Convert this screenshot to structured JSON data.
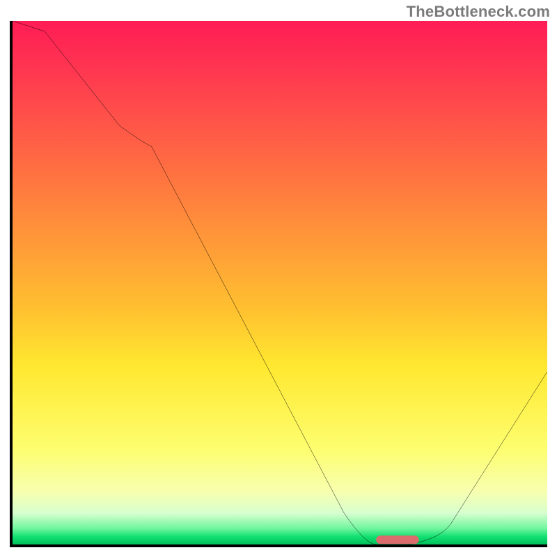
{
  "attribution": "TheBottleneck.com",
  "chart_data": {
    "type": "line",
    "title": "",
    "xlabel": "",
    "ylabel": "",
    "xlim": [
      0,
      100
    ],
    "ylim": [
      0,
      100
    ],
    "grid": false,
    "legend": false,
    "series": [
      {
        "name": "bottleneck-curve",
        "x": [
          0,
          6,
          20,
          26,
          62,
          68,
          74,
          82,
          100
        ],
        "y": [
          100,
          98,
          80,
          76,
          6,
          0,
          0,
          4,
          33
        ]
      }
    ],
    "marker": {
      "name": "optimal-range",
      "x_start": 68,
      "x_end": 76,
      "y": 0,
      "color": "#DB6B6C"
    },
    "background_gradient_stops": [
      {
        "pos": 0.0,
        "color": "#FF1C55"
      },
      {
        "pos": 0.1,
        "color": "#FF3850"
      },
      {
        "pos": 0.3,
        "color": "#FF7440"
      },
      {
        "pos": 0.55,
        "color": "#FFC030"
      },
      {
        "pos": 0.66,
        "color": "#FFE830"
      },
      {
        "pos": 0.82,
        "color": "#FDFE70"
      },
      {
        "pos": 0.9,
        "color": "#F7FFB0"
      },
      {
        "pos": 0.94,
        "color": "#D8FFCF"
      },
      {
        "pos": 0.97,
        "color": "#6EF59D"
      },
      {
        "pos": 0.985,
        "color": "#12E070"
      },
      {
        "pos": 1.0,
        "color": "#00C05B"
      }
    ]
  }
}
